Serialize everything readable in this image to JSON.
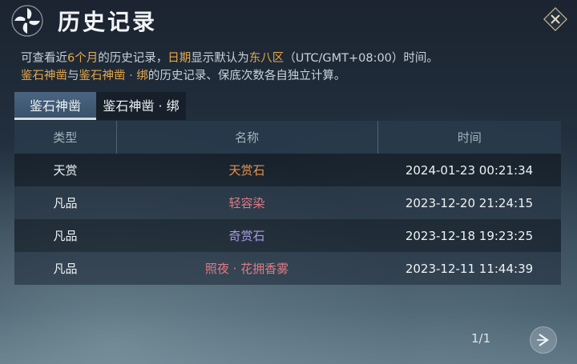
{
  "header": {
    "title": "历史记录"
  },
  "info": {
    "line1_a": "可查看近",
    "line1_months": "6个月",
    "line1_b": "的历史记录，",
    "line1_date": "日期",
    "line1_c": "显示默认为",
    "line1_zone": "东八区",
    "line1_d": "（UTC/GMT+08:00）时间。",
    "line2_pool1": "鉴石神凿",
    "line2_and": "与",
    "line2_pool2": "鉴石神凿 · 绑",
    "line2_rest": "的历史记录、保底次数各自独立计算。"
  },
  "tabs": [
    {
      "label": "鉴石神凿",
      "active": true
    },
    {
      "label": "鉴石神凿 · 绑",
      "active": false
    }
  ],
  "table": {
    "headers": [
      "类型",
      "名称",
      "时间"
    ],
    "rows": [
      {
        "type": "天赏",
        "name": "天赏石",
        "name_color": "#e8924a",
        "time": "2024-01-23 00:21:34"
      },
      {
        "type": "凡品",
        "name": "轻容染",
        "name_color": "#e07a86",
        "time": "2023-12-20 21:24:15"
      },
      {
        "type": "凡品",
        "name": "奇赏石",
        "name_color": "#a99ae6",
        "time": "2023-12-18 19:23:25"
      },
      {
        "type": "凡品",
        "name": "照夜 · 花拥香雾",
        "name_color": "#e07a86",
        "time": "2023-12-11 11:44:39"
      }
    ]
  },
  "pager": {
    "text": "1/1"
  },
  "icons": {
    "logo": "pinwheel-logo-icon",
    "close": "close-icon",
    "next": "chevron-right-icon"
  }
}
